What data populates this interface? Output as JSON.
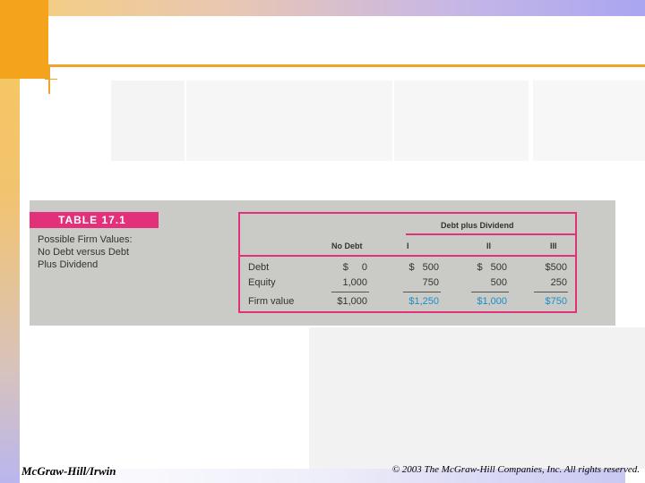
{
  "table": {
    "label": "TABLE 17.1",
    "caption": [
      "Possible Firm Values:",
      "No Debt versus Debt",
      "Plus Dividend"
    ],
    "group_header": "Debt plus Dividend",
    "columns": [
      "No Debt",
      "I",
      "II",
      "III"
    ],
    "rows": [
      {
        "label": "Debt",
        "values": [
          "$ 0",
          "$ 500",
          "$ 500",
          "$500"
        ]
      },
      {
        "label": "Equity",
        "values": [
          "1,000",
          "750",
          "500",
          "250"
        ]
      },
      {
        "label": "Firm value",
        "values": [
          "$1,000",
          "$1,250",
          "$1,000",
          "$750"
        ]
      }
    ]
  },
  "footer": {
    "publisher": "McGraw-Hill/Irwin",
    "copyright": "© 2003 The McGraw-Hill Companies, Inc. All rights reserved."
  },
  "colors": {
    "accent": "#f4a41c",
    "table_pink": "#e2307a",
    "highlight_blue": "#1a8fc9"
  }
}
